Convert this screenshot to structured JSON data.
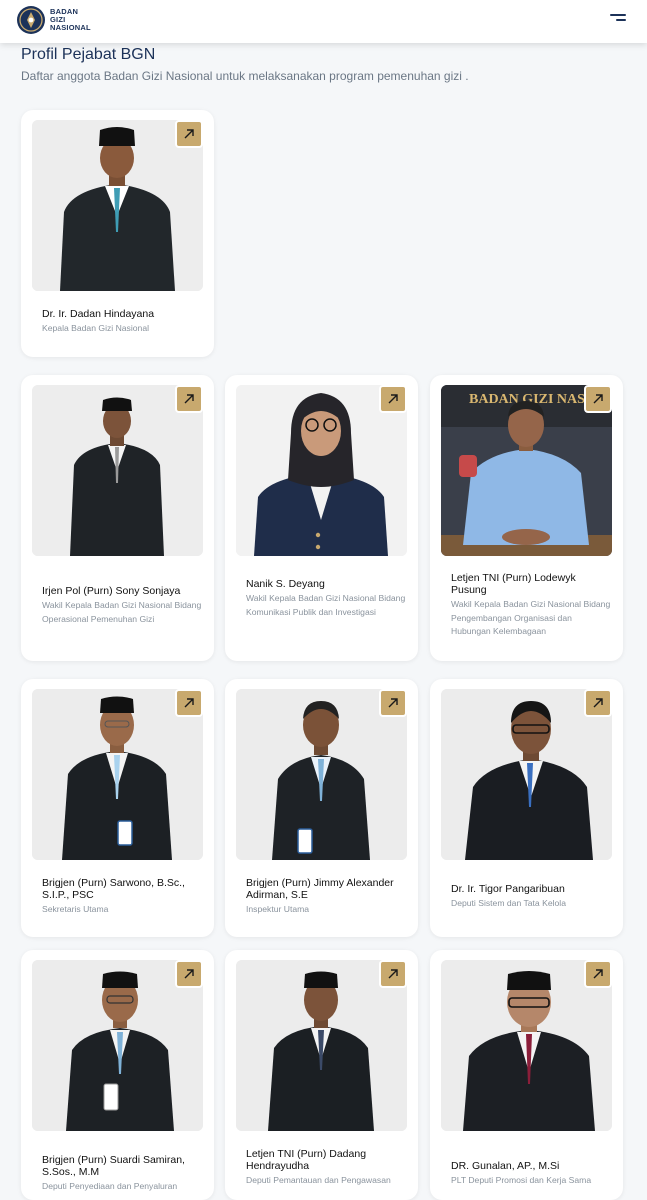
{
  "header": {
    "logo_lines": [
      "BADAN",
      "GIZI",
      "NASIONAL"
    ]
  },
  "page": {
    "title": "Profil Pejabat BGN",
    "subtitle": "Daftar anggota Badan Gizi Nasional untuk melaksanakan program pemenuhan gizi ."
  },
  "officials": [
    {
      "name": "Dr. Ir. Dadan Hindayana",
      "role": "Kepala Badan Gizi Nasional"
    },
    {
      "name": "Irjen Pol (Purn) Sony Sonjaya",
      "role": "Wakil Kepala Badan Gizi Nasional Bidang Operasional Pemenuhan Gizi"
    },
    {
      "name": "Nanik S. Deyang",
      "role": "Wakil Kepala Badan Gizi Nasional Bidang Komunikasi Publik dan Investigasi"
    },
    {
      "name": "Letjen TNI (Purn) Lodewyk Pusung",
      "role": "Wakil Kepala Badan Gizi Nasional Bidang Pengembangan Organisasi dan Hubungan Kelembagaan",
      "banner_text": "BADAN GIZI NASIO"
    },
    {
      "name": "Brigjen (Purn) Sarwono, B.Sc., S.I.P., PSC",
      "role": "Sekretaris Utama"
    },
    {
      "name": "Brigjen (Purn) Jimmy Alexander Adirman, S.E",
      "role": "Inspektur Utama"
    },
    {
      "name": "Dr. Ir. Tigor Pangaribuan",
      "role": "Deputi Sistem dan Tata Kelola"
    },
    {
      "name": "Brigjen (Purn) Suardi Samiran, S.Sos., M.M",
      "role": "Deputi Penyediaan dan Penyaluran"
    },
    {
      "name": "Letjen TNI (Purn) Dadang Hendrayudha",
      "role": "Deputi Pemantauan dan Pengawasan"
    },
    {
      "name": "DR. Gunalan, AP., M.Si",
      "role": "PLT Deputi Promosi dan Kerja Sama"
    }
  ],
  "colors": {
    "accent": "#c8a96e",
    "brand_navy": "#1c3259",
    "background": "#f5f7f9"
  },
  "icons": {
    "card_action": "arrow-up-right-icon",
    "menu": "hamburger-menu-icon"
  }
}
